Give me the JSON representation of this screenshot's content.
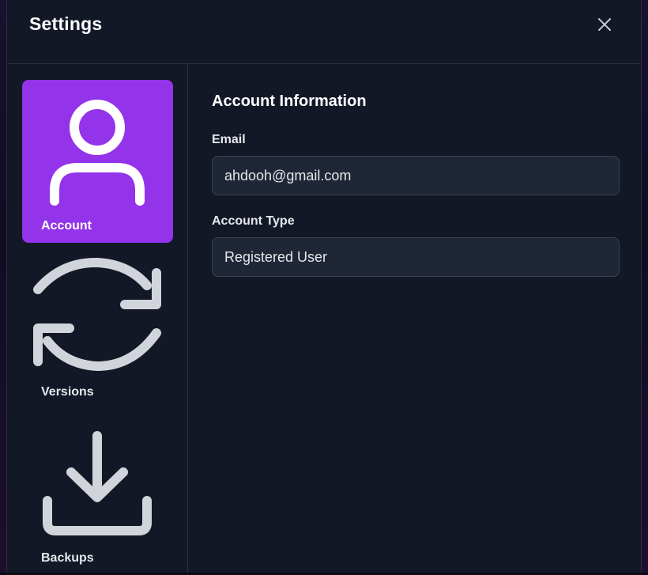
{
  "modal": {
    "title": "Settings",
    "close_icon": "close-icon"
  },
  "sidebar": {
    "items": [
      {
        "label": "Account",
        "icon": "user-icon",
        "active": true
      },
      {
        "label": "Versions",
        "icon": "refresh-icon",
        "active": false
      },
      {
        "label": "Backups",
        "icon": "download-icon",
        "active": false
      }
    ]
  },
  "account": {
    "section_title": "Account Information",
    "email_label": "Email",
    "email_value": "ahdooh@gmail.com",
    "type_label": "Account Type",
    "type_value": "Registered User"
  },
  "colors": {
    "accent": "#9333ea",
    "panel_bg": "#121826",
    "input_bg": "#1f2736",
    "text": "#e5e7eb"
  }
}
